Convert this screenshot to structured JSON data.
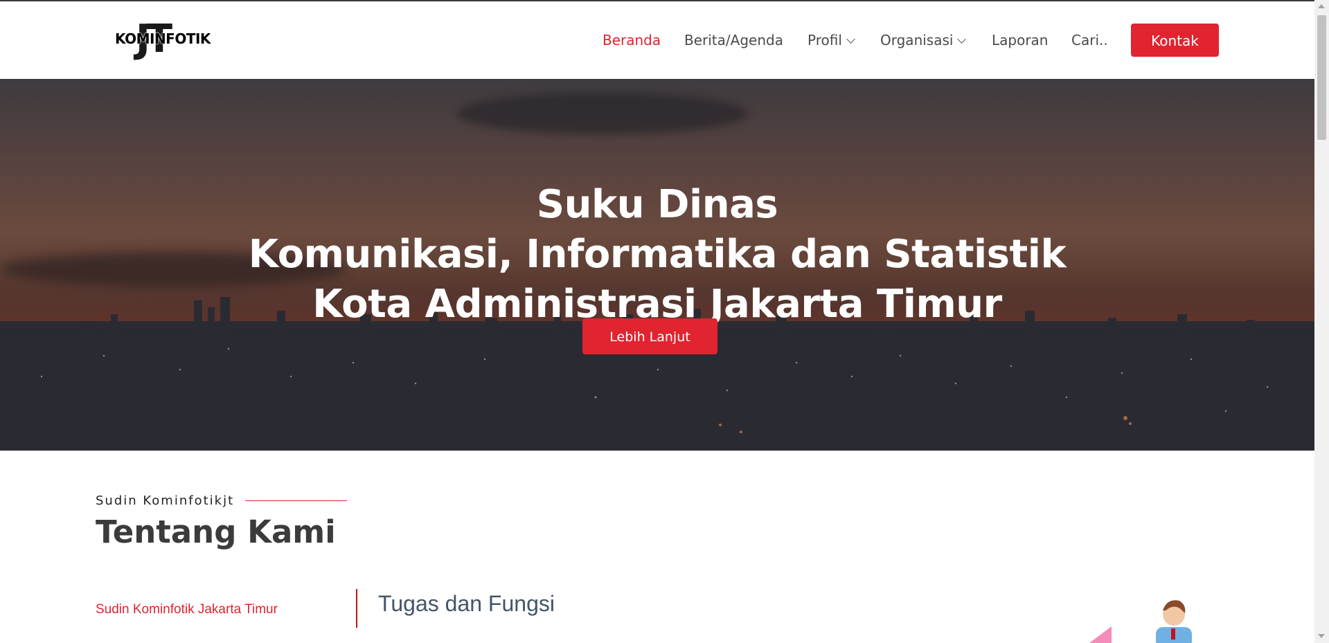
{
  "header": {
    "logo": {
      "mark": "JT",
      "text": "KOMINFOTIK"
    },
    "nav": [
      {
        "label": "Beranda",
        "active": true
      },
      {
        "label": "Berita/Agenda"
      },
      {
        "label": "Profil",
        "dropdown": true
      },
      {
        "label": "Organisasi",
        "dropdown": true
      },
      {
        "label": "Laporan"
      },
      {
        "label": "Cari.."
      }
    ],
    "cta_label": "Kontak"
  },
  "hero": {
    "title_line1": "Suku Dinas",
    "title_line2": "Komunikasi, Informatika dan Statistik",
    "title_line3": "Kota Administrasi Jakarta Timur",
    "button_label": "Lebih Lanjut"
  },
  "about": {
    "subtitle": "Sudin Kominfotikjt",
    "title": "Tentang Kami",
    "side_link": "Sudin Kominfotik Jakarta Timur",
    "content_title": "Tugas dan Fungsi"
  },
  "colors": {
    "accent": "#e02430",
    "text": "#4a4a4a",
    "heading": "#3b3b3b",
    "content_heading": "#44546a"
  }
}
